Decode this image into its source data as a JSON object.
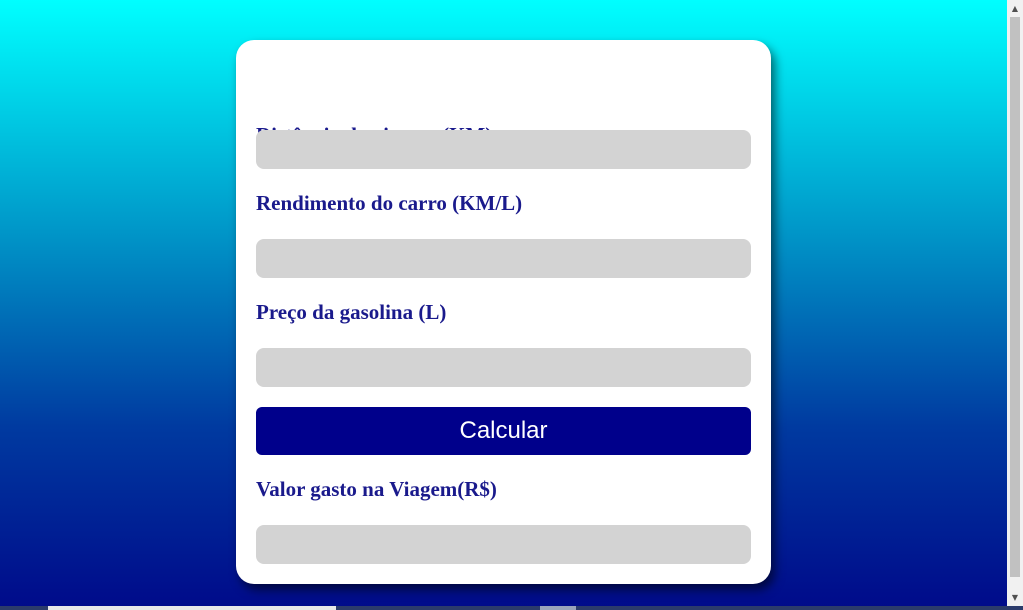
{
  "form": {
    "distance_label": "Distância da viagem (KM)",
    "distance_value": "",
    "efficiency_label": "Rendimento do carro (KM/L)",
    "efficiency_value": "",
    "price_label": "Preço da gasolina (L)",
    "price_value": "",
    "calculate_label": "Calcular",
    "result_label": "Valor gasto na Viagem(R$)",
    "result_value": ""
  },
  "colors": {
    "background_top": "#00ffff",
    "background_bottom": "#000a8a",
    "label_text": "#1a1a8c",
    "button_bg": "#00008b",
    "input_bg": "#d3d3d3"
  },
  "scrollbar": {
    "up_icon": "arrow-up-icon",
    "down_icon": "arrow-down-icon"
  }
}
